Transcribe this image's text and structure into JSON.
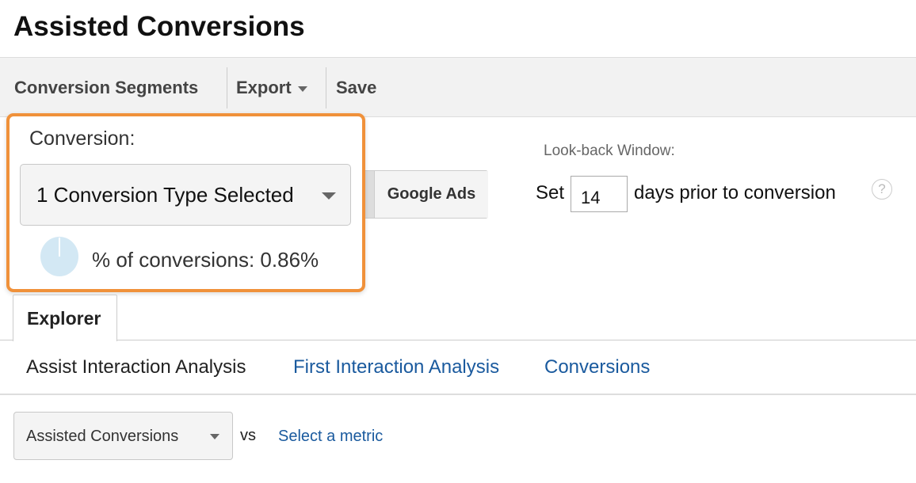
{
  "page": {
    "title": "Assisted Conversions"
  },
  "toolbar": {
    "conversion_segments": "Conversion Segments",
    "export": "Export",
    "save": "Save"
  },
  "conversion_popup": {
    "label": "Conversion:",
    "selected": "1 Conversion Type Selected",
    "percent_text": "% of conversions: 0.86%",
    "percent_value": 0.86
  },
  "type_filter": {
    "partial_label": ":",
    "google_ads": "Google Ads"
  },
  "lookback": {
    "label": "Look-back Window:",
    "prefix": "Set",
    "days": "14",
    "suffix": "days prior to conversion",
    "help": "?"
  },
  "tabs": {
    "explorer": "Explorer"
  },
  "subtabs": [
    {
      "label": "Assist Interaction Analysis",
      "active": true
    },
    {
      "label": "First Interaction Analysis",
      "active": false
    },
    {
      "label": "Conversions",
      "active": false
    }
  ],
  "metric": {
    "primary": "Assisted Conversions",
    "vs": "vs",
    "select": "Select a metric"
  },
  "colors": {
    "highlight": "#f0913a",
    "link": "#1a5a9e",
    "pie": "#d3e8f4"
  }
}
